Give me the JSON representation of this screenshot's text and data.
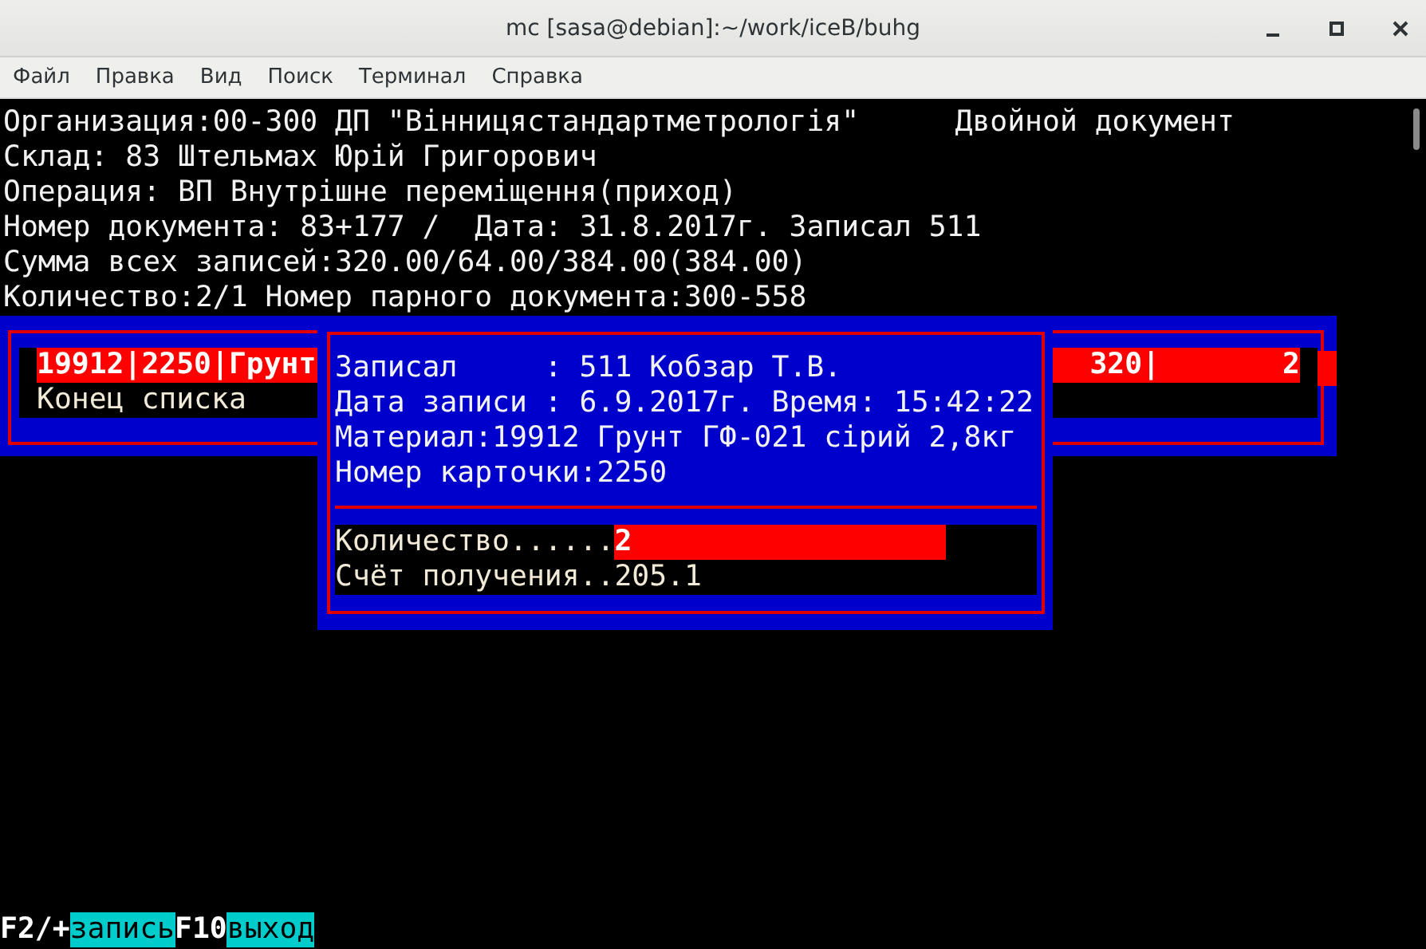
{
  "window": {
    "title": "mc [sasa@debian]:~/work/iceB/buhg"
  },
  "menu": [
    "Файл",
    "Правка",
    "Вид",
    "Поиск",
    "Терминал",
    "Справка"
  ],
  "info_lines": [
    {
      "text": "Организация:00-300 ДП \"Вінницястандартметрологія\"",
      "note": "Двойной документ"
    },
    {
      "text": "Склад: 83 Штельмах Юрій Григорович"
    },
    {
      "text": "Операция: ВП Внутрішне переміщення(приход)"
    },
    {
      "text": "Номер документа: 83+177 /  Дата: 31.8.2017г. Записал 511"
    },
    {
      "text": "Сумма всех записей:320.00/64.00/384.00(384.00)"
    },
    {
      "text": "Количество:2/1 Номер парного документа:300-558"
    }
  ],
  "list": [
    {
      "left": "19912|2250|Грунт",
      "right_1": "320|",
      "right_2": "2",
      "selected": true
    },
    {
      "left": "Конец списка",
      "selected": false
    }
  ],
  "dialog": {
    "lines": [
      "Записал     : 511 Кобзар Т.В.",
      "Дата записи : 6.9.2017г. Время: 15:42:22",
      "Материал:19912 Грунт ГФ-021 сірий 2,8кг",
      "Номер карточки:2250"
    ],
    "fields": [
      {
        "label": "Количество......",
        "value": "2",
        "focused": true
      },
      {
        "label": "Счёт получения..",
        "value": "205.1",
        "focused": false
      }
    ]
  },
  "keys": [
    {
      "key": "F2/+",
      "action": "запись"
    },
    {
      "key": "F10",
      "action": "выход"
    }
  ]
}
